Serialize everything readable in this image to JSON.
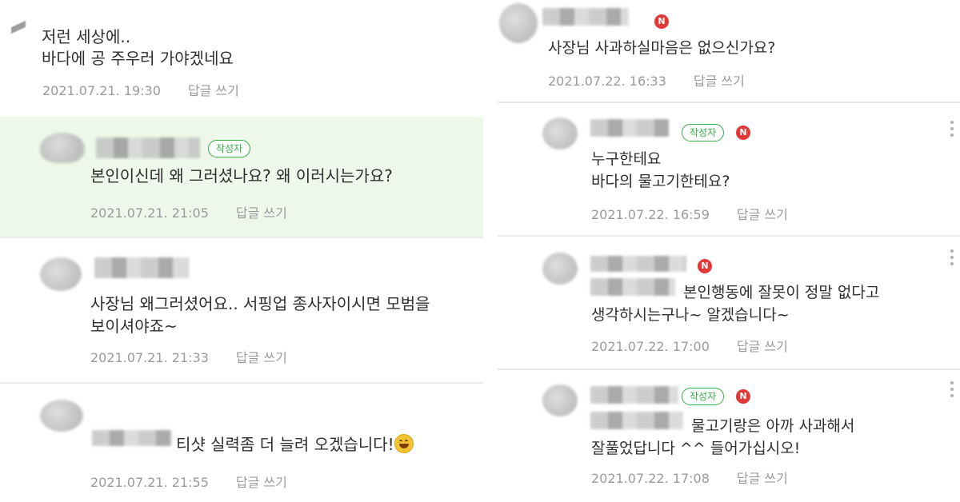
{
  "left": {
    "comments": [
      {
        "text": [
          "저런 세상에..",
          "바다에 공 주우러 가야겠네요"
        ],
        "date": "2021.07.21. 19:30",
        "reply": "답글 쓰기"
      },
      {
        "badge": "작성자",
        "text": [
          "본인이신데 왜 그러셨나요? 왜 이러시는가요?"
        ],
        "date": "2021.07.21. 21:05",
        "reply": "답글 쓰기"
      },
      {
        "text": [
          "사장님 왜그러셨어요.. 서핑업 종사자이시면 모범을",
          "보이셔야죠~"
        ],
        "date": "2021.07.21. 21:33",
        "reply": "답글 쓰기"
      },
      {
        "text": [
          "티샷 실력좀 더 늘려 오겠습니다!"
        ],
        "date": "2021.07.21. 21:55",
        "reply": "답글 쓰기"
      }
    ]
  },
  "right": {
    "comments": [
      {
        "new": "N",
        "text": [
          "사장님 사과하실마음은 없으신가요?"
        ],
        "date": "2021.07.22. 16:33",
        "reply": "답글 쓰기"
      },
      {
        "badge": "작성자",
        "new": "N",
        "text": [
          "누구한테요",
          "바다의 물고기한테요?"
        ],
        "date": "2021.07.22. 16:59",
        "reply": "답글 쓰기"
      },
      {
        "new": "N",
        "text": [
          "본인행동에 잘못이 정말 없다고",
          "생각하시는구나~ 알겠습니다~"
        ],
        "date": "2021.07.22. 17:00",
        "reply": "답글 쓰기"
      },
      {
        "badge": "작성자",
        "new": "N",
        "text": [
          "물고기랑은 아까 사과해서",
          "잘풀었답니다 ^^ 들어가십시오!"
        ],
        "date": "2021.07.22. 17:08",
        "reply": "답글 쓰기"
      }
    ]
  }
}
